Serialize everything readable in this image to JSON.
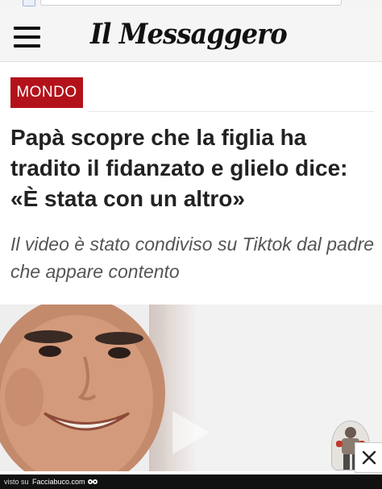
{
  "header": {
    "logo_text": "Il Messaggero",
    "menu_icon": "hamburger-menu-icon"
  },
  "article": {
    "section": "MONDO",
    "headline": "Papà scopre che la figlia ha tradito il fidanzato e glielo dice: «È stata con un altro»",
    "subtitle": "Il video è stato condiviso su Tiktok dal padre che appare contento"
  },
  "video": {
    "play_icon": "play-icon",
    "close_icon": "close-icon"
  },
  "footer": {
    "visto_su": "visto su",
    "brand": "Facciabuco.com"
  },
  "colors": {
    "section_badge": "#b3121a",
    "header_bg": "#f5f5f5",
    "headline": "#222222",
    "subtitle": "#555555"
  }
}
